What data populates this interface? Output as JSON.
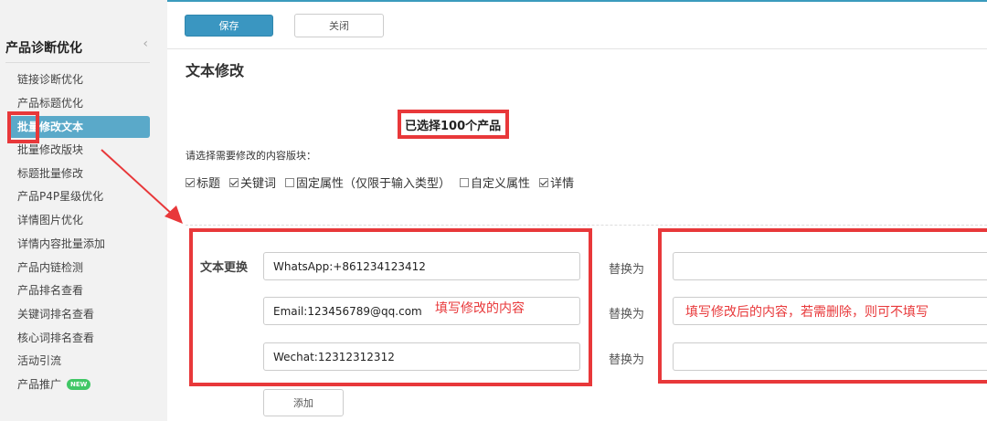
{
  "sidebar": {
    "title": "产品诊断优化",
    "collapse_glyph": "‹",
    "items": [
      {
        "label": "链接诊断优化"
      },
      {
        "label": "产品标题优化"
      },
      {
        "label": "批量修改文本"
      },
      {
        "label": "批量修改版块"
      },
      {
        "label": "标题批量修改"
      },
      {
        "label": "产品P4P星级优化"
      },
      {
        "label": "详情图片优化"
      },
      {
        "label": "详情内容批量添加"
      },
      {
        "label": "产品内链检测"
      },
      {
        "label": "产品排名查看"
      },
      {
        "label": "关键词排名查看"
      },
      {
        "label": "核心词排名查看"
      },
      {
        "label": "活动引流"
      },
      {
        "label": "产品推广",
        "badge": "NEW"
      }
    ]
  },
  "toolbar": {
    "save_label": "保存",
    "close_label": "关闭"
  },
  "main": {
    "title": "文本修改",
    "selected_count": "已选择100个产品",
    "hint": "请选择需要修改的内容版块：",
    "checkboxes": [
      {
        "label": "标题",
        "checked": true
      },
      {
        "label": "关键词",
        "checked": true
      },
      {
        "label": "固定属性（仅限于输入类型）",
        "checked": false
      },
      {
        "label": "自定义属性",
        "checked": false
      },
      {
        "label": "详情",
        "checked": true
      }
    ],
    "row_label": "文本更换",
    "replace_label": "替换为",
    "rows": [
      {
        "find": "WhatsApp:+861234123412",
        "replace": ""
      },
      {
        "find": "Email:123456789@qq.com",
        "replace": ""
      },
      {
        "find": "Wechat:12312312312",
        "replace": ""
      }
    ],
    "add_label": "添加"
  },
  "annotations": {
    "left_note": "填写修改的内容",
    "right_note": "填写修改后的内容，若需删除，则可不填写",
    "color": "#e8383a"
  },
  "colors": {
    "accent": "#3a96c1",
    "active_item": "#5aa9c9",
    "badge": "#41c766"
  }
}
